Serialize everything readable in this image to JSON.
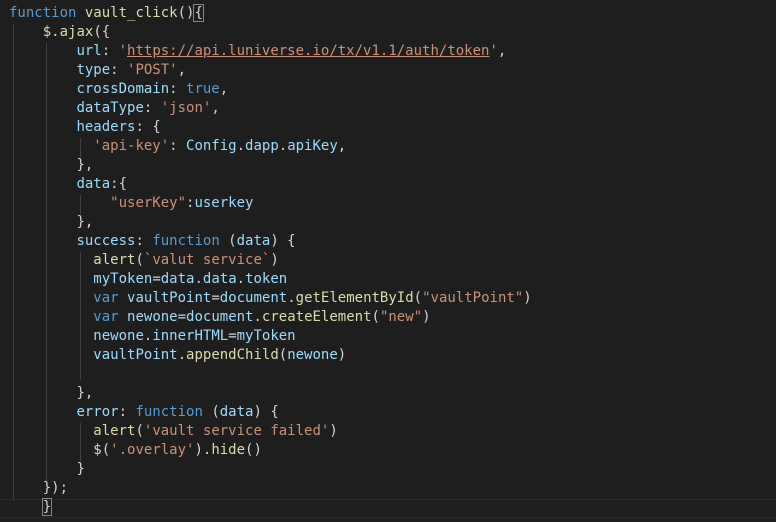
{
  "editor": {
    "theme_colors": {
      "background": "#1e1e1e",
      "text": "#d4d4d4",
      "keyword": "#569cd6",
      "function": "#dcdcaa",
      "property": "#9cdcfe",
      "string": "#ce9178"
    },
    "lines": [
      [
        [
          "keyword",
          "function"
        ],
        [
          "plain",
          " "
        ],
        [
          "func",
          "vault_click"
        ],
        [
          "plain",
          "()"
        ],
        [
          "plain",
          "{"
        ]
      ],
      [
        [
          "plain",
          "    "
        ],
        [
          "func",
          "$"
        ],
        [
          "plain",
          "."
        ],
        [
          "func",
          "ajax"
        ],
        [
          "plain",
          "({"
        ]
      ],
      [
        [
          "plain",
          "        "
        ],
        [
          "prop",
          "url"
        ],
        [
          "plain",
          ": "
        ],
        [
          "string",
          "'"
        ],
        [
          "url",
          "https://api.luniverse.io/tx/v1.1/auth/token"
        ],
        [
          "string",
          "'"
        ],
        [
          "plain",
          ","
        ]
      ],
      [
        [
          "plain",
          "        "
        ],
        [
          "prop",
          "type"
        ],
        [
          "plain",
          ": "
        ],
        [
          "string",
          "'POST'"
        ],
        [
          "plain",
          ","
        ]
      ],
      [
        [
          "plain",
          "        "
        ],
        [
          "prop",
          "crossDomain"
        ],
        [
          "plain",
          ": "
        ],
        [
          "keyword",
          "true"
        ],
        [
          "plain",
          ","
        ]
      ],
      [
        [
          "plain",
          "        "
        ],
        [
          "prop",
          "dataType"
        ],
        [
          "plain",
          ": "
        ],
        [
          "string",
          "'json'"
        ],
        [
          "plain",
          ","
        ]
      ],
      [
        [
          "plain",
          "        "
        ],
        [
          "prop",
          "headers"
        ],
        [
          "plain",
          ": {"
        ]
      ],
      [
        [
          "plain",
          "          "
        ],
        [
          "string",
          "'api-key'"
        ],
        [
          "plain",
          ": "
        ],
        [
          "prop",
          "Config"
        ],
        [
          "plain",
          "."
        ],
        [
          "prop",
          "dapp"
        ],
        [
          "plain",
          "."
        ],
        [
          "prop",
          "apiKey"
        ],
        [
          "plain",
          ","
        ]
      ],
      [
        [
          "plain",
          "        "
        ],
        [
          "plain",
          "},"
        ]
      ],
      [
        [
          "plain",
          "        "
        ],
        [
          "prop",
          "data"
        ],
        [
          "plain",
          ":{"
        ]
      ],
      [
        [
          "plain",
          "            "
        ],
        [
          "string",
          "\"userKey\""
        ],
        [
          "plain",
          ":"
        ],
        [
          "prop",
          "userkey"
        ]
      ],
      [
        [
          "plain",
          "        "
        ],
        [
          "plain",
          "},"
        ]
      ],
      [
        [
          "plain",
          "        "
        ],
        [
          "prop",
          "success"
        ],
        [
          "plain",
          ": "
        ],
        [
          "keyword",
          "function"
        ],
        [
          "plain",
          " ("
        ],
        [
          "prop",
          "data"
        ],
        [
          "plain",
          ") {"
        ]
      ],
      [
        [
          "plain",
          "          "
        ],
        [
          "func",
          "alert"
        ],
        [
          "plain",
          "("
        ],
        [
          "string",
          "`valut service`"
        ],
        [
          "plain",
          ")"
        ]
      ],
      [
        [
          "plain",
          "          "
        ],
        [
          "prop",
          "myToken"
        ],
        [
          "plain",
          "="
        ],
        [
          "prop",
          "data"
        ],
        [
          "plain",
          "."
        ],
        [
          "prop",
          "data"
        ],
        [
          "plain",
          "."
        ],
        [
          "prop",
          "token"
        ]
      ],
      [
        [
          "plain",
          "          "
        ],
        [
          "keyword",
          "var"
        ],
        [
          "plain",
          " "
        ],
        [
          "prop",
          "vaultPoint"
        ],
        [
          "plain",
          "="
        ],
        [
          "prop",
          "document"
        ],
        [
          "plain",
          "."
        ],
        [
          "func",
          "getElementById"
        ],
        [
          "plain",
          "("
        ],
        [
          "string",
          "\"vaultPoint\""
        ],
        [
          "plain",
          ")"
        ]
      ],
      [
        [
          "plain",
          "          "
        ],
        [
          "keyword",
          "var"
        ],
        [
          "plain",
          " "
        ],
        [
          "prop",
          "newone"
        ],
        [
          "plain",
          "="
        ],
        [
          "prop",
          "document"
        ],
        [
          "plain",
          "."
        ],
        [
          "func",
          "createElement"
        ],
        [
          "plain",
          "("
        ],
        [
          "string",
          "\"new\""
        ],
        [
          "plain",
          ")"
        ]
      ],
      [
        [
          "plain",
          "          "
        ],
        [
          "prop",
          "newone"
        ],
        [
          "plain",
          "."
        ],
        [
          "prop",
          "innerHTML"
        ],
        [
          "plain",
          "="
        ],
        [
          "prop",
          "myToken"
        ]
      ],
      [
        [
          "plain",
          "          "
        ],
        [
          "prop",
          "vaultPoint"
        ],
        [
          "plain",
          "."
        ],
        [
          "func",
          "appendChild"
        ],
        [
          "plain",
          "("
        ],
        [
          "prop",
          "newone"
        ],
        [
          "plain",
          ")"
        ]
      ],
      [
        [
          "plain",
          ""
        ]
      ],
      [
        [
          "plain",
          "        "
        ],
        [
          "plain",
          "},"
        ]
      ],
      [
        [
          "plain",
          "        "
        ],
        [
          "prop",
          "error"
        ],
        [
          "plain",
          ": "
        ],
        [
          "keyword",
          "function"
        ],
        [
          "plain",
          " ("
        ],
        [
          "prop",
          "data"
        ],
        [
          "plain",
          ") {"
        ]
      ],
      [
        [
          "plain",
          "          "
        ],
        [
          "func",
          "alert"
        ],
        [
          "plain",
          "("
        ],
        [
          "string",
          "'vault service failed'"
        ],
        [
          "plain",
          ")"
        ]
      ],
      [
        [
          "plain",
          "          "
        ],
        [
          "func",
          "$"
        ],
        [
          "plain",
          "("
        ],
        [
          "string",
          "'.overlay'"
        ],
        [
          "plain",
          ")."
        ],
        [
          "func",
          "hide"
        ],
        [
          "plain",
          "()"
        ]
      ],
      [
        [
          "plain",
          "        "
        ],
        [
          "plain",
          "}"
        ]
      ],
      [
        [
          "plain",
          "    "
        ],
        [
          "plain",
          "});"
        ]
      ],
      [
        [
          "plain",
          "    "
        ],
        [
          "plain",
          "}"
        ]
      ]
    ]
  }
}
